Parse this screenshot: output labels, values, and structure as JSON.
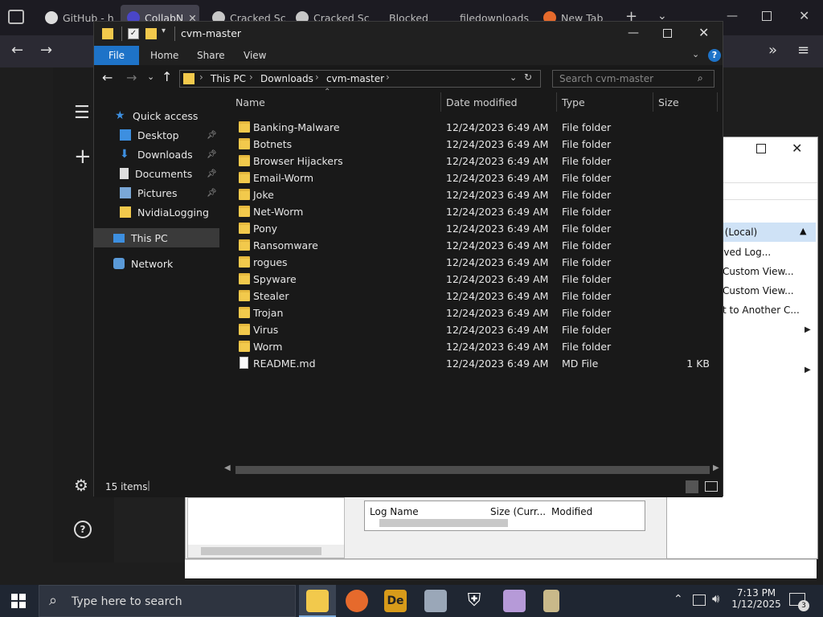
{
  "browser": {
    "tabs": [
      {
        "label": "GitHub - h"
      },
      {
        "label": "CollabN"
      },
      {
        "label": "Cracked Sc"
      },
      {
        "label": "Cracked Sc"
      },
      {
        "label": "Blocked"
      },
      {
        "label": "filedownloads"
      },
      {
        "label": "New Tab"
      }
    ]
  },
  "eventviewer": {
    "items": [
      "r (Local)",
      "aved Log...",
      "Custom View...",
      "Custom View...",
      "t to Another C..."
    ],
    "columns": [
      "Log Name",
      "Size (Curr...",
      "Modified"
    ]
  },
  "explorer": {
    "title": "cvm-master",
    "ribbon": [
      "File",
      "Home",
      "Share",
      "View"
    ],
    "breadcrumb": [
      "This PC",
      "Downloads",
      "cvm-master"
    ],
    "search_placeholder": "Search cvm-master",
    "nav": [
      {
        "label": "Quick access",
        "icon": "star-icon"
      },
      {
        "label": "Desktop",
        "icon": "desktop-icon",
        "pinned": true
      },
      {
        "label": "Downloads",
        "icon": "download-icon",
        "pinned": true
      },
      {
        "label": "Documents",
        "icon": "document-icon",
        "pinned": true
      },
      {
        "label": "Pictures",
        "icon": "picture-icon",
        "pinned": true
      },
      {
        "label": "NvidiaLogging",
        "icon": "folder-icon"
      },
      {
        "label": "This PC",
        "icon": "computer-icon",
        "selected": true
      },
      {
        "label": "Network",
        "icon": "network-icon"
      }
    ],
    "columns": [
      "Name",
      "Date modified",
      "Type",
      "Size"
    ],
    "files": [
      {
        "name": "Banking-Malware",
        "date": "12/24/2023 6:49 AM",
        "type": "File folder",
        "size": ""
      },
      {
        "name": "Botnets",
        "date": "12/24/2023 6:49 AM",
        "type": "File folder",
        "size": ""
      },
      {
        "name": "Browser Hijackers",
        "date": "12/24/2023 6:49 AM",
        "type": "File folder",
        "size": ""
      },
      {
        "name": "Email-Worm",
        "date": "12/24/2023 6:49 AM",
        "type": "File folder",
        "size": ""
      },
      {
        "name": "Joke",
        "date": "12/24/2023 6:49 AM",
        "type": "File folder",
        "size": ""
      },
      {
        "name": "Net-Worm",
        "date": "12/24/2023 6:49 AM",
        "type": "File folder",
        "size": ""
      },
      {
        "name": "Pony",
        "date": "12/24/2023 6:49 AM",
        "type": "File folder",
        "size": ""
      },
      {
        "name": "Ransomware",
        "date": "12/24/2023 6:49 AM",
        "type": "File folder",
        "size": ""
      },
      {
        "name": "rogues",
        "date": "12/24/2023 6:49 AM",
        "type": "File folder",
        "size": ""
      },
      {
        "name": "Spyware",
        "date": "12/24/2023 6:49 AM",
        "type": "File folder",
        "size": ""
      },
      {
        "name": "Stealer",
        "date": "12/24/2023 6:49 AM",
        "type": "File folder",
        "size": ""
      },
      {
        "name": "Trojan",
        "date": "12/24/2023 6:49 AM",
        "type": "File folder",
        "size": ""
      },
      {
        "name": "Virus",
        "date": "12/24/2023 6:49 AM",
        "type": "File folder",
        "size": ""
      },
      {
        "name": "Worm",
        "date": "12/24/2023 6:49 AM",
        "type": "File folder",
        "size": ""
      },
      {
        "name": "README.md",
        "date": "12/24/2023 6:49 AM",
        "type": "MD File",
        "size": "1 KB"
      }
    ],
    "status": "15 items"
  },
  "taskbar": {
    "search_placeholder": "Type here to search",
    "time": "7:13 PM",
    "date": "1/12/2025",
    "notification_count": "3"
  },
  "colors": {
    "accent": "#1e73c8",
    "folder": "#f2c94c",
    "taskbar": "#1f2632"
  }
}
